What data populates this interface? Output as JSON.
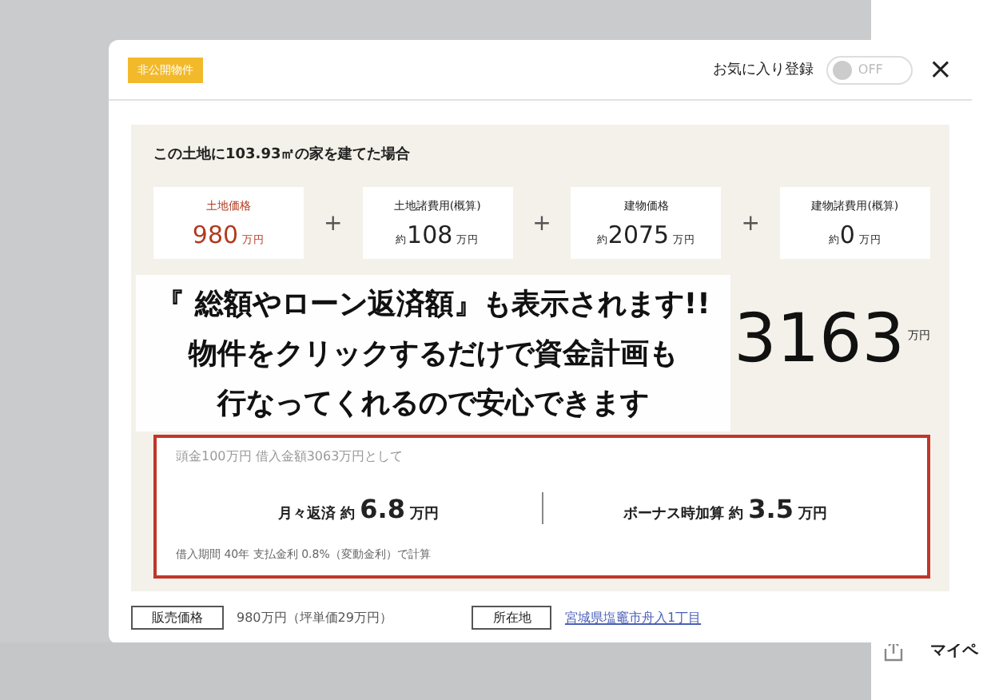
{
  "modal": {
    "badge": "非公開物件",
    "favorite": {
      "label": "お気に入り登録",
      "toggle_text": "OFF",
      "on": false
    },
    "close": "×"
  },
  "plan": {
    "heading": "この土地に103.93㎡の家を建てた場合",
    "costs": [
      {
        "label": "土地価格",
        "amount": "980",
        "unit": "万円",
        "kind": "highlight"
      },
      {
        "label": "土地諸費用(概算)",
        "prefix": "約",
        "amount": "108",
        "unit": "万円",
        "kind": "plain"
      },
      {
        "label": "建物価格",
        "prefix": "約",
        "amount": "2075",
        "unit": "万円",
        "kind": "plain"
      },
      {
        "label": "建物諸費用(概算)",
        "prefix": "約",
        "amount": "0",
        "unit": "万円",
        "kind": "plain"
      }
    ],
    "plus": "+",
    "total": {
      "amount": "3163",
      "unit": "万円"
    },
    "loan": {
      "condition": "頭金100万円 借入金額3063万円として",
      "items": [
        {
          "label": "月々返済 約",
          "amount": "6.8",
          "unit": "万円"
        },
        {
          "label": "ボーナス時加算 約",
          "amount": "3.5",
          "unit": "万円"
        }
      ],
      "note": "借入期間 40年 支払金利 0.8%（変動金利）で計算"
    }
  },
  "details": [
    {
      "label": "販売価格",
      "value": "980万円（坪単価29万円）",
      "kind": "text"
    },
    {
      "label": "所在地",
      "value": "宮城県塩竈市舟入1丁目",
      "kind": "link"
    }
  ],
  "side": {
    "label": "マイペ"
  },
  "caption": {
    "lines": [
      "『 総額やローン返済額』も表示されます!!",
      "物件をクリックするだけで資金計画も",
      "行なってくれるので安心できます"
    ]
  }
}
